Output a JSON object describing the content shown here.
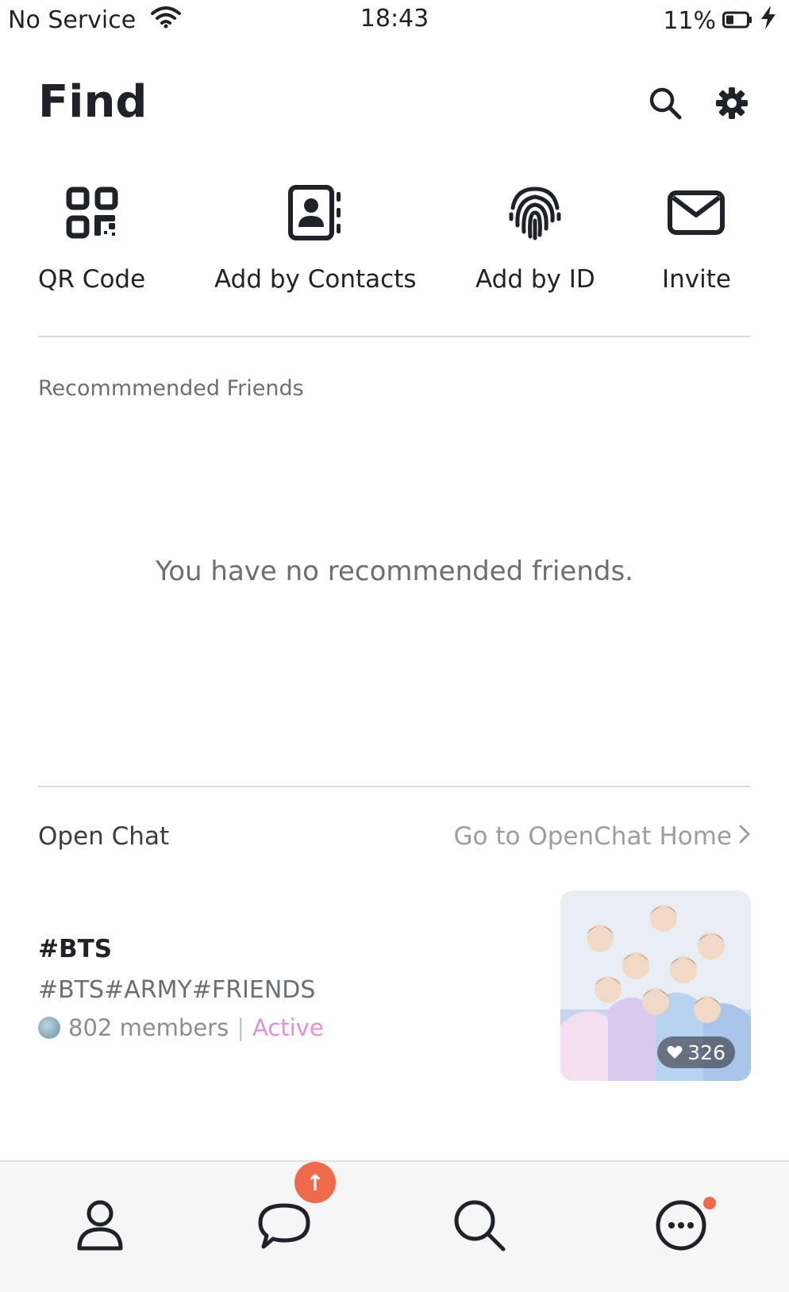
{
  "status": {
    "carrier": "No Service",
    "time": "18:43",
    "battery": "11%",
    "icons": [
      "wifi-icon",
      "battery-icon",
      "charging-icon"
    ]
  },
  "header": {
    "title": "Find",
    "icons": [
      "search-icon",
      "gear-icon"
    ]
  },
  "quick_actions": [
    {
      "label": "QR Code",
      "icon": "qr-code-icon"
    },
    {
      "label": "Add by Contacts",
      "icon": "contacts-book-icon"
    },
    {
      "label": "Add by ID",
      "icon": "fingerprint-icon"
    },
    {
      "label": "Invite",
      "icon": "envelope-icon"
    }
  ],
  "recommended": {
    "label": "Recommmended Friends",
    "empty_message": "You have no recommended friends."
  },
  "openchat": {
    "title": "Open Chat",
    "link_label": "Go to OpenChat Home",
    "card": {
      "name": "#BTS",
      "tags": "#BTS#ARMY#FRIENDS",
      "members": "802 members",
      "separator": "|",
      "status": "Active",
      "likes": "326"
    }
  },
  "tabbar": {
    "items": [
      "profile-icon",
      "chat-bubble-icon",
      "search-icon",
      "more-icon"
    ],
    "chat_badge": "↑"
  },
  "colors": {
    "accent_badge": "#ef6a4b",
    "active_status": "#e48fd8",
    "text_primary": "#1f2327",
    "text_secondary": "#6b6f73"
  }
}
